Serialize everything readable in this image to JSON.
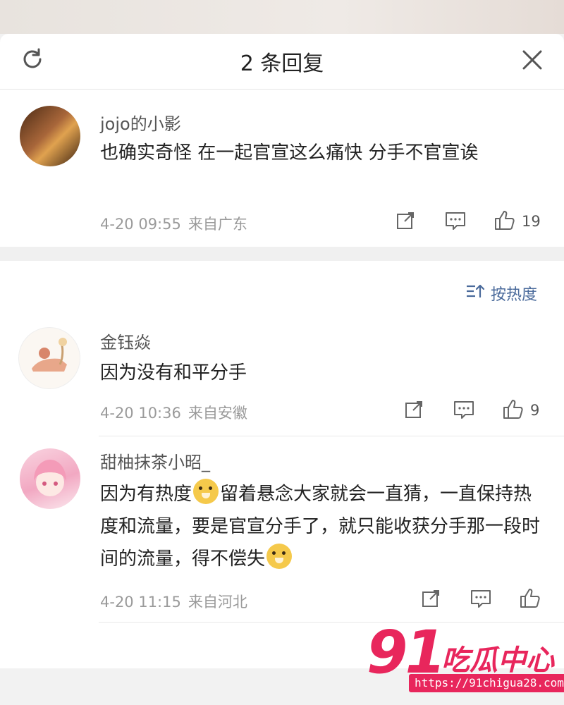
{
  "header": {
    "title": "2 条回复",
    "refresh_icon": "refresh-icon",
    "close_icon": "close-icon"
  },
  "main_comment": {
    "author": "jojo的小影",
    "text": "也确实奇怪 在一起官宣这么痛快 分手不官宣诶",
    "date": "4-20 09:55",
    "location": "来自广东",
    "likes": "19"
  },
  "sort": {
    "label": "按热度",
    "icon": "sort-icon"
  },
  "replies": [
    {
      "author": "金钰焱",
      "text": "因为没有和平分手",
      "date": "4-20 10:36",
      "location": "来自安徽",
      "likes": "9"
    },
    {
      "author": "甜柚抹茶小昭_",
      "text_parts": [
        "因为有热度",
        "留着悬念大家就会一直猜，一直保持热度和流量，要是官宣分手了，就只能收获分手那一段时间的流量，得不偿失"
      ],
      "date": "4-20 11:15",
      "location": "来自河北",
      "likes": ""
    }
  ],
  "watermark": {
    "number": "91",
    "name": "吃瓜中心",
    "url": "https://91chigua28.com"
  },
  "colors": {
    "accent": "#4a6a9b",
    "watermark": "#e8265c"
  }
}
